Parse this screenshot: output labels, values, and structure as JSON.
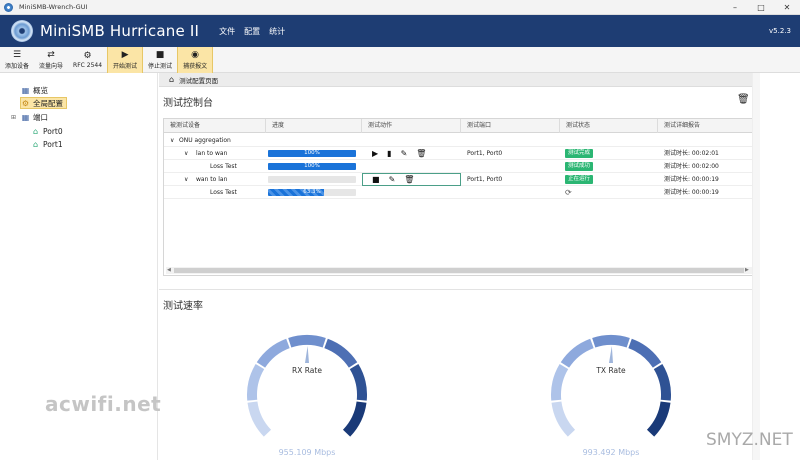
{
  "window": {
    "title": "MiniSMB-Wrench-GUI"
  },
  "header": {
    "app_title": "MiniSMB Hurricane II",
    "menu": [
      "文件",
      "配置",
      "统计"
    ],
    "version": "v5.2.3"
  },
  "toolbar": {
    "buttons": [
      {
        "label": "添加设备",
        "icon": "server-icon"
      },
      {
        "label": "流量向导",
        "icon": "shuffle-icon"
      },
      {
        "label": "RFC 2544",
        "icon": "network-icon"
      },
      {
        "label": "开始测试",
        "icon": "play-icon",
        "active": true
      },
      {
        "label": "停止测试",
        "icon": "stop-icon"
      },
      {
        "label": "捕获报文",
        "icon": "eye-icon",
        "active": true
      }
    ]
  },
  "sidebar": {
    "items": [
      {
        "label": "概览",
        "icon": "grid-icon"
      },
      {
        "label": "全局配置",
        "icon": "gear-icon",
        "selected": true
      },
      {
        "label": "端口",
        "icon": "port-group-icon"
      },
      {
        "label": "Port0",
        "icon": "port-icon"
      },
      {
        "label": "Port1",
        "icon": "port-icon"
      }
    ]
  },
  "breadcrumb": {
    "label": "测试配置页面"
  },
  "control": {
    "title": "测试控制台"
  },
  "grid": {
    "columns": [
      "被测试设备",
      "进度",
      "测试动作",
      "测试端口",
      "测试状态",
      "测试详细报告"
    ],
    "rows": [
      {
        "name": "ONU aggregation",
        "level": 0
      },
      {
        "name": "lan to wan",
        "level": 1,
        "progress": 100,
        "progress_label": "100%",
        "port": "Port1, Port0",
        "status": "测试完成",
        "report": "测试时长: 00:02:01"
      },
      {
        "name": "Loss Test",
        "level": 2,
        "progress": 100,
        "progress_label": "100%",
        "status": "测试成功",
        "report": "测试时长: 00:02:00"
      },
      {
        "name": "wan to lan",
        "level": 1,
        "progress": 0,
        "progress_label": "",
        "port": "Port1, Port0",
        "status": "正在运行",
        "report": "测试时长: 00:00:19"
      },
      {
        "name": "Loss Test",
        "level": 2,
        "progress": 63.3,
        "progress_label": "63.3%",
        "status": "",
        "report": "测试时长: 00:00:19"
      }
    ]
  },
  "speed": {
    "title": "测试速率",
    "gauges": [
      {
        "label": "RX Rate",
        "value_text": "955.109 Mbps",
        "value": 955.109,
        "max": 1000
      },
      {
        "label": "TX Rate",
        "value_text": "993.492 Mbps",
        "value": 993.492,
        "max": 1000
      }
    ]
  },
  "watermarks": [
    "acwifi.net",
    "SMYZ.NET"
  ],
  "colors": {
    "header_bg": "#1e3d73",
    "accent": "#1a73d9",
    "status_green": "#2bb673",
    "active_btn": "#fbe5a6"
  }
}
